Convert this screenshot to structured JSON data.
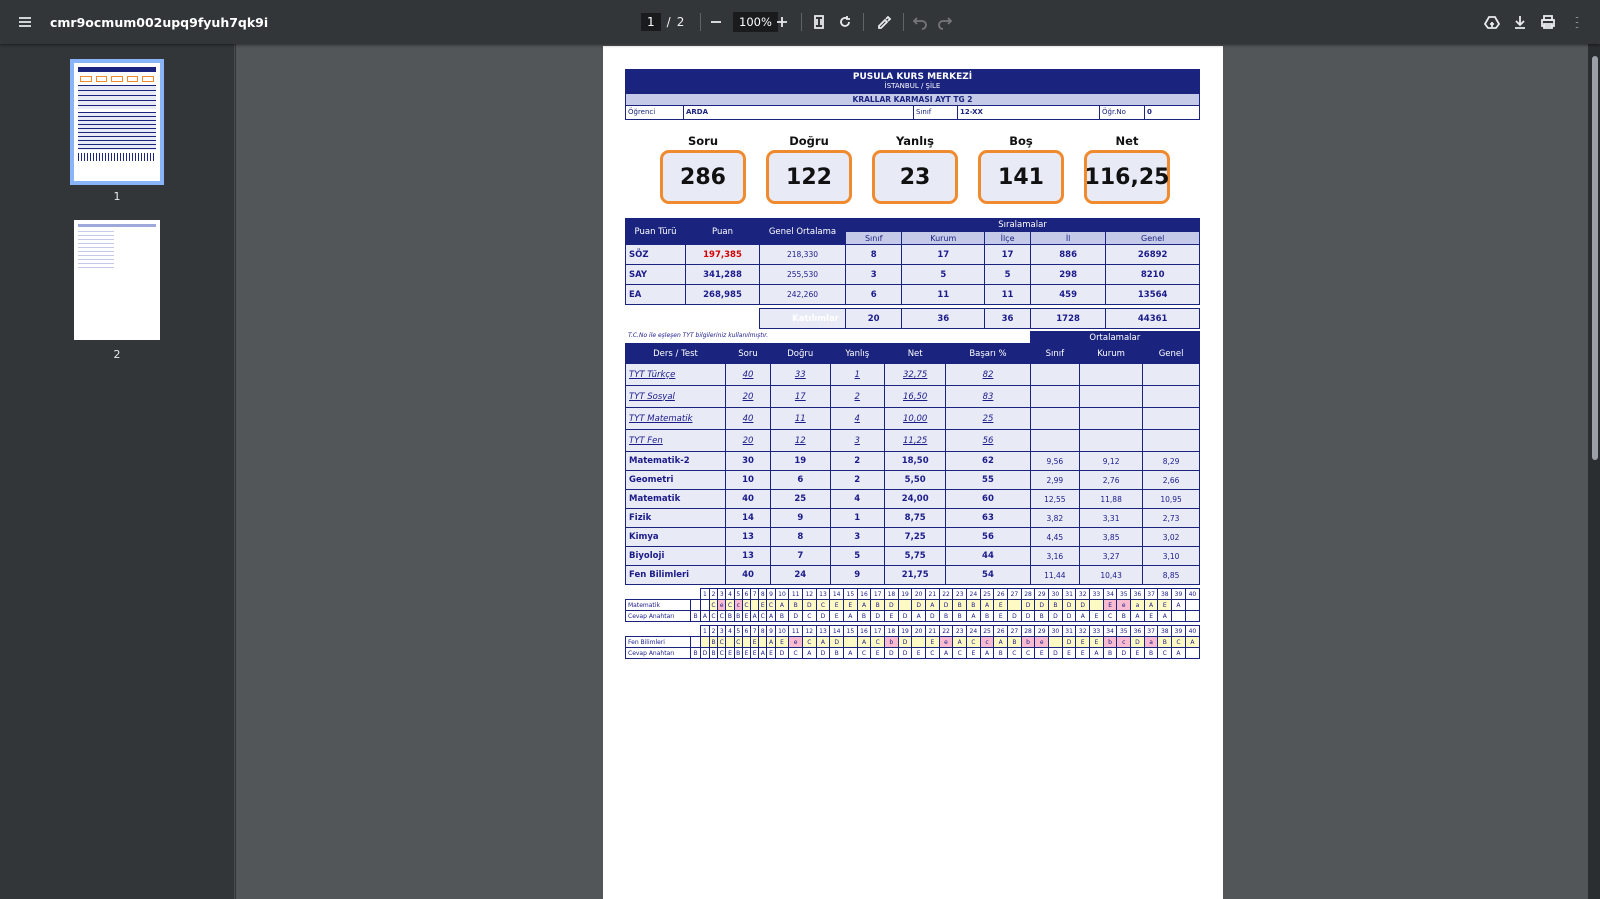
{
  "toolbar": {
    "title": "cmr9ocmum002upq9fyuh7qk9i",
    "page_current": "1",
    "page_total": "2",
    "zoom": "100%"
  },
  "sidebar": {
    "thumbs": [
      "1",
      "2"
    ]
  },
  "doc": {
    "header_title": "PUSULA KURS MERKEZİ",
    "header_sub": "İSTANBUL / ŞİLE",
    "exam": "KRALLAR KARMASI AYT TG 2",
    "info": {
      "ogr_label": "Öğrenci",
      "ogr": "ARDA",
      "sinif_label": "Sınıf",
      "sinif": "12-XX",
      "no_label": "Öğr.No",
      "no": "0"
    },
    "stats": [
      {
        "label": "Soru",
        "value": "286"
      },
      {
        "label": "Doğru",
        "value": "122"
      },
      {
        "label": "Yanlış",
        "value": "23"
      },
      {
        "label": "Boş",
        "value": "141"
      },
      {
        "label": "Net",
        "value": "116,25"
      }
    ],
    "score_headers": {
      "puan_turu": "Puan Türü",
      "puan": "Puan",
      "genel_ort": "Genel Ortalama",
      "siralamalar": "Sıralamalar",
      "sinif": "Sınıf",
      "kurum": "Kurum",
      "ilce": "İlçe",
      "il": "İl",
      "genel": "Genel"
    },
    "scores": [
      {
        "tur": "SÖZ",
        "puan": "197,385",
        "ort": "218,330",
        "sinif": "8",
        "kurum": "17",
        "ilce": "17",
        "il": "886",
        "genel": "26892"
      },
      {
        "tur": "SAY",
        "puan": "341,288",
        "ort": "255,530",
        "sinif": "3",
        "kurum": "5",
        "ilce": "5",
        "il": "298",
        "genel": "8210"
      },
      {
        "tur": "EA",
        "puan": "268,985",
        "ort": "242,260",
        "sinif": "6",
        "kurum": "11",
        "ilce": "11",
        "il": "459",
        "genel": "13564"
      }
    ],
    "katilim": {
      "label": "Katılımlar",
      "sinif": "20",
      "kurum": "36",
      "ilce": "36",
      "il": "1728",
      "genel": "44361"
    },
    "note": "T.C.No ile eşleşen TYT bilgileriniz kullanılmıştır.",
    "lesson_headers": {
      "ders": "Ders / Test",
      "soru": "Soru",
      "dogru": "Doğru",
      "yanlis": "Yanlış",
      "net": "Net",
      "basari": "Başarı %",
      "ortalamalar": "Ortalamalar",
      "sinif": "Sınıf",
      "kurum": "Kurum",
      "genel": "Genel"
    },
    "tyt": [
      {
        "ders": "TYT Türkçe",
        "soru": "40",
        "dogru": "33",
        "yanlis": "1",
        "net": "32,75",
        "basari": "82"
      },
      {
        "ders": "TYT Sosyal",
        "soru": "20",
        "dogru": "17",
        "yanlis": "2",
        "net": "16,50",
        "basari": "83"
      },
      {
        "ders": "TYT Matematik",
        "soru": "40",
        "dogru": "11",
        "yanlis": "4",
        "net": "10,00",
        "basari": "25"
      },
      {
        "ders": "TYT Fen",
        "soru": "20",
        "dogru": "12",
        "yanlis": "3",
        "net": "11,25",
        "basari": "56"
      }
    ],
    "mat": [
      {
        "ders": "Matematik-2",
        "soru": "30",
        "dogru": "19",
        "yanlis": "2",
        "net": "18,50",
        "basari": "62",
        "s": "9,56",
        "k": "9,12",
        "g": "8,29"
      },
      {
        "ders": "Geometri",
        "soru": "10",
        "dogru": "6",
        "yanlis": "2",
        "net": "5,50",
        "basari": "55",
        "s": "2,99",
        "k": "2,76",
        "g": "2,66"
      },
      {
        "ders": "Matematik",
        "soru": "40",
        "dogru": "25",
        "yanlis": "4",
        "net": "24,00",
        "basari": "60",
        "s": "12,55",
        "k": "11,88",
        "g": "10,95"
      }
    ],
    "fen": [
      {
        "ders": "Fizik",
        "soru": "14",
        "dogru": "9",
        "yanlis": "1",
        "net": "8,75",
        "basari": "63",
        "s": "3,82",
        "k": "3,31",
        "g": "2,73"
      },
      {
        "ders": "Kimya",
        "soru": "13",
        "dogru": "8",
        "yanlis": "3",
        "net": "7,25",
        "basari": "56",
        "s": "4,45",
        "k": "3,85",
        "g": "3,02"
      },
      {
        "ders": "Biyoloji",
        "soru": "13",
        "dogru": "7",
        "yanlis": "5",
        "net": "5,75",
        "basari": "44",
        "s": "3,16",
        "k": "3,27",
        "g": "3,10"
      },
      {
        "ders": "Fen Bilimleri",
        "soru": "40",
        "dogru": "24",
        "yanlis": "9",
        "net": "21,75",
        "basari": "54",
        "s": "11,44",
        "k": "10,43",
        "g": "8,85"
      }
    ],
    "answers": [
      {
        "label": "Matematik",
        "key_label": "Cevap Anahtarı",
        "k0": "B",
        "student": " ,C,e,C,c,C, ,E,C,A,B,D,C,E,E,A,B,D, ,D,A,D,B,B,A,E, ,D,D,B,D,D, ,E,e,a,A,E,A, ",
        "key": "A,C,C,B,B,E,A,C,A,B,D,C,D,E,A,B,D,E,D,A,D,B,B,A,B,E,D,D,B,D,D,A,E,C,B,A,E,A, , ",
        "marks": " ,y,p,y,p,y,y,y,y,y,y,y,y,y,y,y,y,y,y,y,y,y,y,y,y,y,y,y,y,y,y,y,y,p,p,y,y,y, , "
      },
      {
        "label": "Fen Bilimleri",
        "key_label": "Cevap Anahtarı",
        "k0": "B",
        "student": " ,B,C, ,C, ,E, ,A,E,e,C,A,D, ,A,C,b,D, ,E,e,A,C,c,A,B,b,e, ,D,E,E,b,c,D,a,B,C,A",
        "key": "D,B,C,E,B,E,E,A,E,D,C,A,D,B,A,C,E,D,D,E,C,A,C,E,A,B,C,C,E,D,E,E,A,B,D,E,B,C,A, ",
        "marks": "y,y,y,y,y,y,y,y,y,y,p,y,y,y,y,y,y,p,y,y,y,p,y,y,p,y,y,p,p,y,y,y,y,p,p,y,p,y,y,y"
      }
    ],
    "answer_numbers": [
      "1",
      "2",
      "3",
      "4",
      "5",
      "6",
      "7",
      "8",
      "9",
      "10",
      "11",
      "12",
      "13",
      "14",
      "15",
      "16",
      "17",
      "18",
      "19",
      "20",
      "21",
      "22",
      "23",
      "24",
      "25",
      "26",
      "27",
      "28",
      "29",
      "30",
      "31",
      "32",
      "33",
      "34",
      "35",
      "36",
      "37",
      "38",
      "39",
      "40"
    ]
  }
}
